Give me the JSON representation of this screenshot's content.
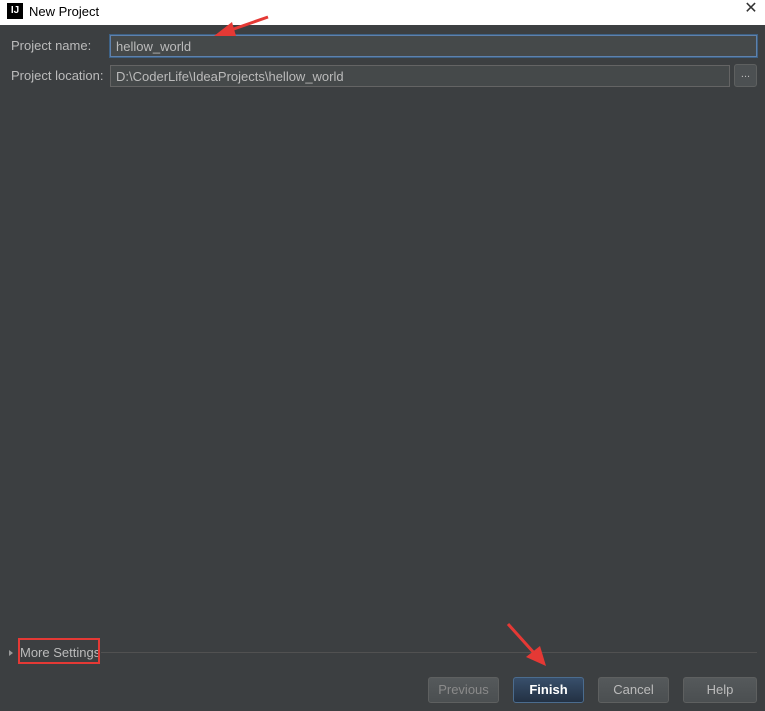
{
  "window": {
    "title": "New Project",
    "icon_label": "IJ",
    "close_glyph": "✕"
  },
  "form": {
    "name_label": "Project name:",
    "name_value": "hellow_world",
    "location_label": "Project location:",
    "location_value": "D:\\CoderLife\\IdeaProjects\\hellow_world",
    "browse_label": "..."
  },
  "more_settings": {
    "label": "More Settings"
  },
  "buttons": {
    "previous": "Previous",
    "finish": "Finish",
    "cancel": "Cancel",
    "help": "Help"
  },
  "colors": {
    "background": "#3c3f41",
    "annotation_red": "#e53935",
    "default_button": "#2b3d52"
  }
}
